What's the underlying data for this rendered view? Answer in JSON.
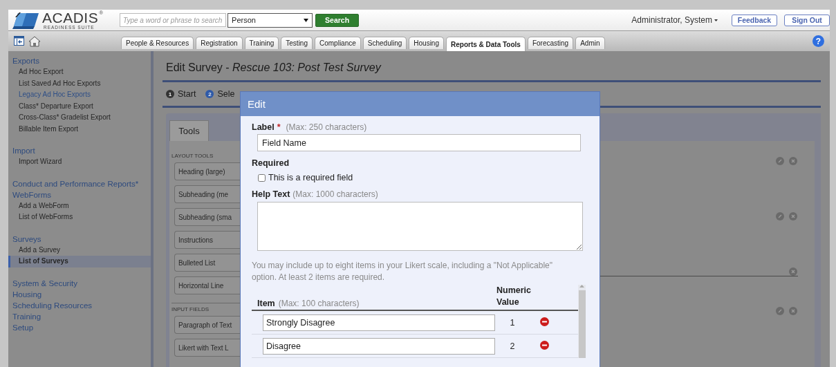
{
  "header": {
    "logo": {
      "name": "ACADIS",
      "registered": "®",
      "tagline": "READINESS SUITE"
    },
    "search": {
      "placeholder": "Type a word or phrase to search"
    },
    "search_type": {
      "value": "Person"
    },
    "search_button": "Search",
    "user_menu": "Administrator, System",
    "buttons": [
      "Feedback",
      "Sign Out"
    ]
  },
  "tabs": [
    {
      "label": "People & Resources",
      "selected": false
    },
    {
      "label": "Registration",
      "selected": false
    },
    {
      "label": "Training",
      "selected": false
    },
    {
      "label": "Testing",
      "selected": false
    },
    {
      "label": "Compliance",
      "selected": false
    },
    {
      "label": "Scheduling",
      "selected": false
    },
    {
      "label": "Housing",
      "selected": false
    },
    {
      "label": "Reports & Data Tools",
      "selected": true
    },
    {
      "label": "Forecasting",
      "selected": false
    },
    {
      "label": "Admin",
      "selected": false
    }
  ],
  "help_button": "?",
  "sidebar": {
    "sections": [
      {
        "heading": "Exports",
        "items": [
          {
            "label": "Ad Hoc Export",
            "color": "#262626",
            "selected": false
          },
          {
            "label": "List Saved Ad Hoc Exports",
            "color": "#262626",
            "selected": false
          },
          {
            "label": "Legacy Ad Hoc Exports",
            "color": "#2f4f86",
            "selected": false
          },
          {
            "label": "Class* Departure Export",
            "color": "#262626",
            "selected": false
          },
          {
            "label": "Cross-Class* Gradelist Export",
            "color": "#262626",
            "selected": false
          },
          {
            "label": "Billable Item Export",
            "color": "#262626",
            "selected": false
          }
        ]
      },
      {
        "heading": "Import",
        "items": [
          {
            "label": "Import Wizard",
            "color": "#262626",
            "selected": false
          }
        ]
      },
      {
        "heading": "Conduct and Performance Reports*"
      },
      {
        "heading": "WebForms",
        "items": [
          {
            "label": "Add a WebForm",
            "color": "#262626",
            "selected": false
          },
          {
            "label": "List of WebForms",
            "color": "#262626",
            "selected": false
          }
        ]
      },
      {
        "heading": "Surveys",
        "items": [
          {
            "label": "Add a Survey",
            "color": "#262626",
            "selected": false
          },
          {
            "label": "List of Surveys",
            "color": "#262626",
            "selected": true
          }
        ]
      },
      {
        "heading": "System & Security"
      },
      {
        "heading": "Housing"
      },
      {
        "heading": "Scheduling Resources"
      },
      {
        "heading": "Training"
      },
      {
        "heading": "Setup"
      }
    ]
  },
  "page": {
    "title": "Edit Survey - *Rescue 103: Post Test Survey*",
    "steps": [
      {
        "number": "1",
        "label": "Start",
        "selected": false
      },
      {
        "number": "2",
        "label": "Sele",
        "selected": true
      }
    ],
    "tools": {
      "tab": "Tools",
      "groups": [
        {
          "heading": "LAYOUT TOOLS",
          "items": [
            "Heading (large)",
            "Subheading (me",
            "Subheading (sma",
            "Instructions",
            "Bulleted List",
            "Horizontal Line"
          ]
        },
        {
          "heading": "INPUT FIELDS",
          "items": [
            "Paragraph of Text",
            "Likert with Text L"
          ]
        }
      ]
    },
    "survey_rows": [
      {
        "kind": "field"
      },
      {
        "kind": "field"
      },
      {
        "kind": "line"
      },
      {
        "kind": "field"
      }
    ]
  },
  "dialog": {
    "title": "Edit",
    "label_field": {
      "label": "Label",
      "required_mark": "*",
      "hint": "(Max: 250 characters)",
      "value": "Field Name"
    },
    "required": {
      "label": "Required",
      "checkbox": {
        "label": "This is a required field",
        "checked": false
      }
    },
    "help_text": {
      "label": "Help Text",
      "hint": "(Max: 1000 characters)"
    },
    "note": "You may include up to eight items in your Likert scale, including a \"Not Applicable\" option. At least 2 items are required.",
    "items_table": {
      "columns": [
        {
          "label": "Item",
          "hint": "(Max: 100 characters)"
        },
        {
          "label": "Numeric Value"
        }
      ],
      "rows": [
        {
          "item": "Strongly Disagree",
          "value": "1"
        },
        {
          "item": "Disagree",
          "value": "2"
        }
      ]
    }
  }
}
